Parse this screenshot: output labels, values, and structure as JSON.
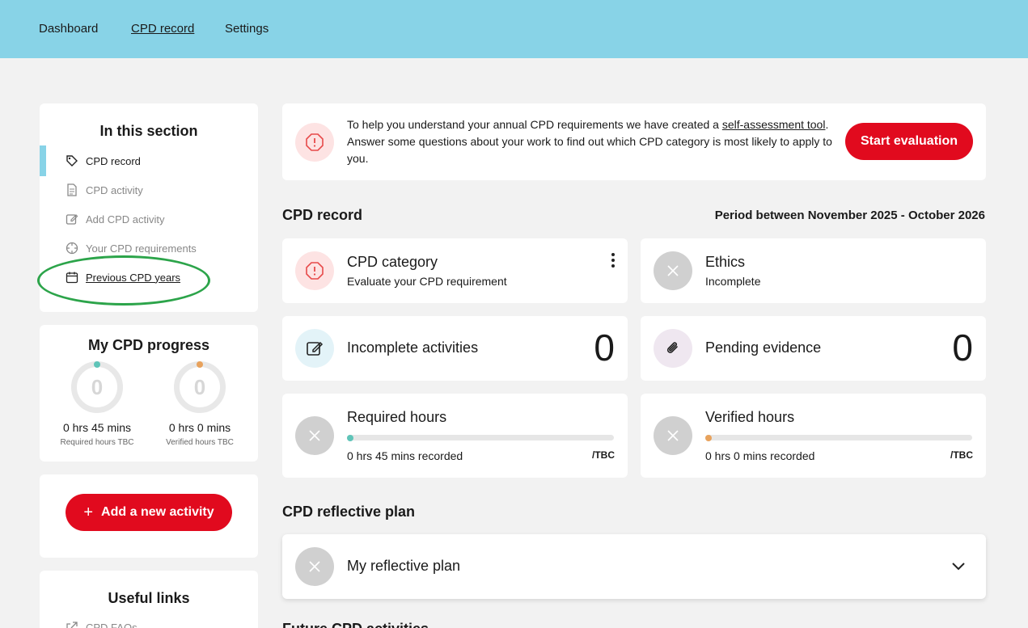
{
  "nav": {
    "dashboard": "Dashboard",
    "cpd_record": "CPD record",
    "settings": "Settings"
  },
  "sidebar": {
    "title": "In this section",
    "items": [
      {
        "label": "CPD record",
        "icon": "tag-icon"
      },
      {
        "label": "CPD activity",
        "icon": "document-icon"
      },
      {
        "label": "Add CPD activity",
        "icon": "edit-icon"
      },
      {
        "label": "Your CPD requirements",
        "icon": "target-icon"
      },
      {
        "label": "Previous CPD years",
        "icon": "calendar-icon"
      }
    ]
  },
  "progress": {
    "title": "My CPD progress",
    "rings": [
      {
        "value": "0",
        "hours": "0 hrs 45 mins",
        "caption": "Required hours TBC",
        "color": "#5fc4b8"
      },
      {
        "value": "0",
        "hours": "0 hrs 0 mins",
        "caption": "Verified hours TBC",
        "color": "#e8a25c"
      }
    ]
  },
  "add_activity": {
    "label": "Add a new activity",
    "plus": "+"
  },
  "useful_links": {
    "title": "Useful links",
    "first": "CPD FAQs"
  },
  "banner": {
    "text_before": "To help you understand your annual CPD requirements we have created a ",
    "link": "self-assessment tool",
    "text_after": ". Answer some questions about your work to find out which CPD category is most likely to apply to you.",
    "button": "Start evaluation"
  },
  "cpd_record": {
    "heading": "CPD record",
    "period": "Period between November 2025 - October 2026",
    "category": {
      "title": "CPD category",
      "sub": "Evaluate your CPD requirement"
    },
    "ethics": {
      "title": "Ethics",
      "sub": "Incomplete"
    },
    "incomplete": {
      "title": "Incomplete activities",
      "count": "0"
    },
    "pending": {
      "title": "Pending evidence",
      "count": "0"
    },
    "required": {
      "title": "Required hours",
      "recorded": "0 hrs 45 mins recorded",
      "target": "/TBC",
      "fraction": 0,
      "color": "#5fc4b8"
    },
    "verified": {
      "title": "Verified hours",
      "recorded": "0 hrs 0 mins recorded",
      "target": "/TBC",
      "fraction": 0,
      "color": "#e8a25c"
    }
  },
  "reflective": {
    "heading": "CPD reflective plan",
    "plan": "My reflective plan"
  },
  "footer_heading_partial": "Future CPD activities",
  "colors": {
    "header": "#88d3e7",
    "accent_red": "#e10a1e",
    "annotation_green": "#2ca44a"
  }
}
